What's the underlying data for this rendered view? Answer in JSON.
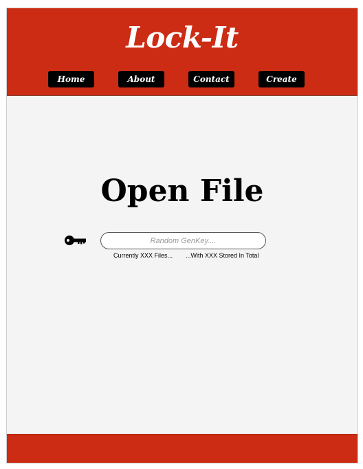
{
  "header": {
    "logo": "Lock-It",
    "nav": [
      "Home",
      "About",
      "Contact",
      "Create"
    ]
  },
  "main": {
    "title": "Open File",
    "key_icon": "key-icon",
    "search": {
      "placeholder": "Random GenKey....",
      "value": ""
    },
    "stats": {
      "files": "Currently XXX Files...",
      "stored": "...With XXX Stored In Total"
    }
  },
  "colors": {
    "header_bg": "#cc2b14",
    "footer_bg": "#cc2b14",
    "nav_bg": "#000000",
    "page_bg": "#f4f4f4"
  }
}
